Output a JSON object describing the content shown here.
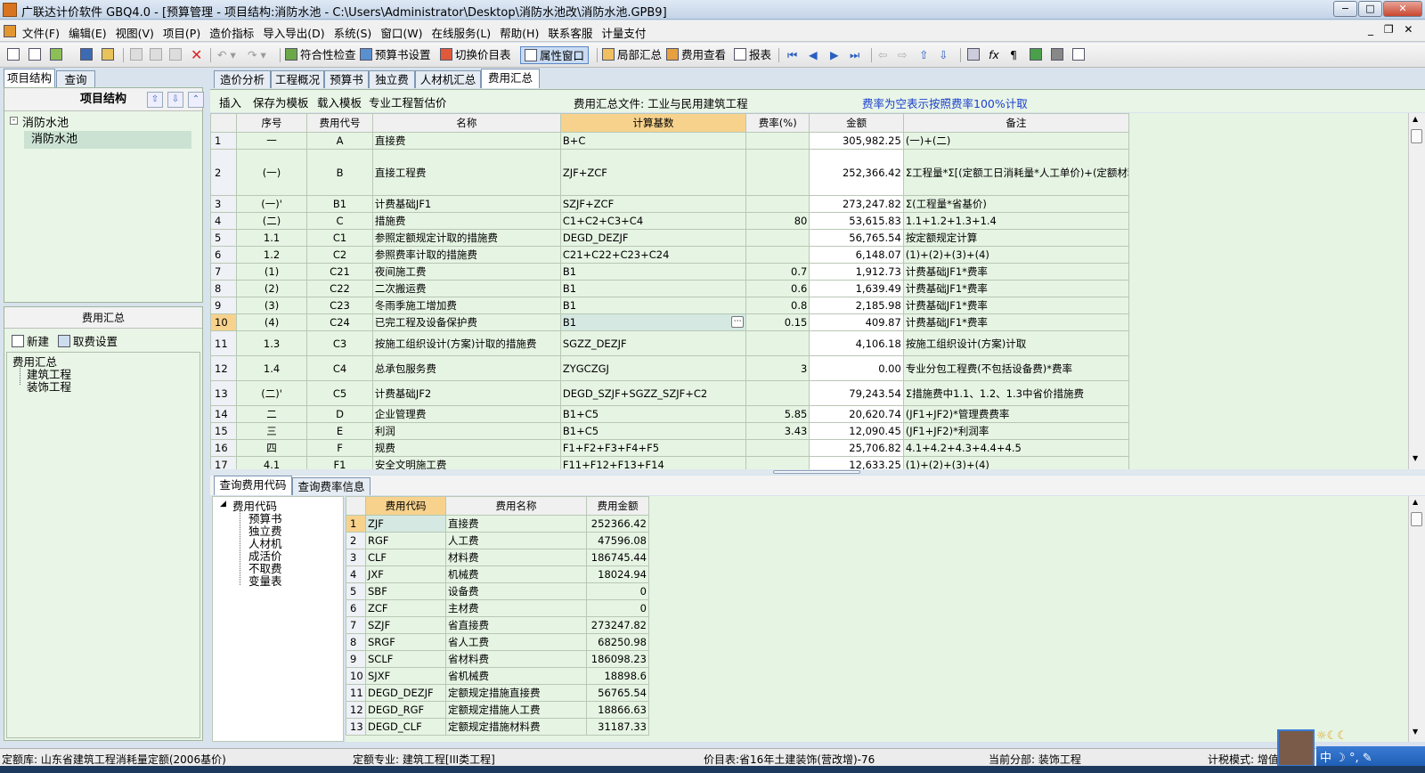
{
  "window": {
    "title": "广联达计价软件 GBQ4.0 - [预算管理 - 项目结构:消防水池 - C:\\Users\\Administrator\\Desktop\\消防水池改\\消防水池.GPB9]",
    "minimize": "−",
    "restore": "□",
    "close": "✕"
  },
  "menu": [
    "文件(F)",
    "编辑(E)",
    "视图(V)",
    "项目(P)",
    "造价指标",
    "导入导出(D)",
    "系统(S)",
    "窗口(W)",
    "在线服务(L)",
    "帮助(H)",
    "联系客服",
    "计量支付"
  ],
  "mdi": {
    "minimize": "_",
    "restore": "❐",
    "close": "✕"
  },
  "toolbar": {
    "check": "符合性检查",
    "budget_settings": "预算书设置",
    "switch_price": "切换价目表",
    "property_window": "属性窗口",
    "local_summary": "局部汇总",
    "fee_view": "费用查看",
    "report": "报表"
  },
  "left_panel": {
    "tabs": [
      "项目结构",
      "查询"
    ],
    "header": "项目结构",
    "tree_root": "消防水池",
    "tree_child": "消防水池",
    "fee_header": "费用汇总",
    "new_btn": "新建",
    "fee_settings_btn": "取费设置",
    "fee_tree_root": "费用汇总",
    "fee_tree_items": [
      "建筑工程",
      "装饰工程"
    ]
  },
  "main_tabs": [
    "造价分析",
    "工程概况",
    "预算书",
    "独立费",
    "人材机汇总",
    "费用汇总"
  ],
  "subtoolbar": {
    "insert": "插入",
    "save_template": "保存为模板",
    "load_template": "载入模板",
    "estimate": "专业工程暂估价",
    "file_label": "费用汇总文件: 工业与民用建筑工程",
    "note": "费率为空表示按照费率100%计取"
  },
  "fee_table": {
    "headers": [
      "序号",
      "费用代号",
      "名称",
      "计算基数",
      "费率(%)",
      "金额",
      "备注"
    ],
    "rows": [
      {
        "n": "1",
        "seq": "一",
        "code": "A",
        "name": "直接费",
        "base": "B+C",
        "rate": "",
        "amount": "305,982.25",
        "note": "(一)+(二)"
      },
      {
        "n": "2",
        "seq": "(一)",
        "code": "B",
        "name": "直接工程费",
        "base": "ZJF+ZCF",
        "rate": "",
        "amount": "252,366.42",
        "note": "Σ工程量*Σ[(定额工日消耗量*人工单价)+(定额材料消耗量*材料单价)+(定额机械台班消耗量*机械台班单价)]"
      },
      {
        "n": "3",
        "seq": "(一)'",
        "code": "B1",
        "name": "计费基础JF1",
        "base": "SZJF+ZCF",
        "rate": "",
        "amount": "273,247.82",
        "note": "Σ(工程量*省基价)"
      },
      {
        "n": "4",
        "seq": "(二)",
        "code": "C",
        "name": "措施费",
        "base": "C1+C2+C3+C4",
        "rate": "80",
        "amount": "53,615.83",
        "note": "1.1+1.2+1.3+1.4"
      },
      {
        "n": "5",
        "seq": "1.1",
        "code": "C1",
        "name": "参照定额规定计取的措施费",
        "base": "DEGD_DEZJF",
        "rate": "",
        "amount": "56,765.54",
        "note": "按定额规定计算"
      },
      {
        "n": "6",
        "seq": "1.2",
        "code": "C2",
        "name": "参照费率计取的措施费",
        "base": "C21+C22+C23+C24",
        "rate": "",
        "amount": "6,148.07",
        "note": "(1)+(2)+(3)+(4)"
      },
      {
        "n": "7",
        "seq": "(1)",
        "code": "C21",
        "name": "夜间施工费",
        "base": "B1",
        "rate": "0.7",
        "amount": "1,912.73",
        "note": "计费基础JF1*费率"
      },
      {
        "n": "8",
        "seq": "(2)",
        "code": "C22",
        "name": "二次搬运费",
        "base": "B1",
        "rate": "0.6",
        "amount": "1,639.49",
        "note": "计费基础JF1*费率"
      },
      {
        "n": "9",
        "seq": "(3)",
        "code": "C23",
        "name": "冬雨季施工增加费",
        "base": "B1",
        "rate": "0.8",
        "amount": "2,185.98",
        "note": "计费基础JF1*费率"
      },
      {
        "n": "10",
        "seq": "(4)",
        "code": "C24",
        "name": "已完工程及设备保护费",
        "base": "B1",
        "rate": "0.15",
        "amount": "409.87",
        "note": "计费基础JF1*费率"
      },
      {
        "n": "11",
        "seq": "1.3",
        "code": "C3",
        "name": "按施工组织设计(方案)计取的措施费",
        "base": "SGZZ_DEZJF",
        "rate": "",
        "amount": "4,106.18",
        "note": "按施工组织设计(方案)计取"
      },
      {
        "n": "12",
        "seq": "1.4",
        "code": "C4",
        "name": "总承包服务费",
        "base": "ZYGCZGJ",
        "rate": "3",
        "amount": "0.00",
        "note": "专业分包工程费(不包括设备费)*费率"
      },
      {
        "n": "13",
        "seq": "(二)'",
        "code": "C5",
        "name": "计费基础JF2",
        "base": "DEGD_SZJF+SGZZ_SZJF+C2",
        "rate": "",
        "amount": "79,243.54",
        "note": "Σ措施费中1.1、1.2、1.3中省价措施费"
      },
      {
        "n": "14",
        "seq": "二",
        "code": "D",
        "name": "企业管理费",
        "base": "B1+C5",
        "rate": "5.85",
        "amount": "20,620.74",
        "note": "(JF1+JF2)*管理费费率"
      },
      {
        "n": "15",
        "seq": "三",
        "code": "E",
        "name": "利润",
        "base": "B1+C5",
        "rate": "3.43",
        "amount": "12,090.45",
        "note": "(JF1+JF2)*利润率"
      },
      {
        "n": "16",
        "seq": "四",
        "code": "F",
        "name": "规费",
        "base": "F1+F2+F3+F4+F5",
        "rate": "",
        "amount": "25,706.82",
        "note": "4.1+4.2+4.3+4.4+4.5"
      },
      {
        "n": "17",
        "seq": "4.1",
        "code": "F1",
        "name": "安全文明施工费",
        "base": "F11+F12+F13+F14",
        "rate": "",
        "amount": "12,633.25",
        "note": "(1)+(2)+(3)+(4)"
      }
    ]
  },
  "bottom_tabs": [
    "查询费用代码",
    "查询费率信息"
  ],
  "code_tree": {
    "root": "费用代码",
    "items": [
      "预算书",
      "独立费",
      "人材机",
      "成活价",
      "不取费",
      "变量表"
    ]
  },
  "code_table": {
    "headers": [
      "费用代码",
      "费用名称",
      "费用金额"
    ],
    "rows": [
      {
        "n": "1",
        "code": "ZJF",
        "name": "直接费",
        "amount": "252366.42"
      },
      {
        "n": "2",
        "code": "RGF",
        "name": "人工费",
        "amount": "47596.08"
      },
      {
        "n": "3",
        "code": "CLF",
        "name": "材料费",
        "amount": "186745.44"
      },
      {
        "n": "4",
        "code": "JXF",
        "name": "机械费",
        "amount": "18024.94"
      },
      {
        "n": "5",
        "code": "SBF",
        "name": "设备费",
        "amount": "0"
      },
      {
        "n": "6",
        "code": "ZCF",
        "name": "主材费",
        "amount": "0"
      },
      {
        "n": "7",
        "code": "SZJF",
        "name": "省直接费",
        "amount": "273247.82"
      },
      {
        "n": "8",
        "code": "SRGF",
        "name": "省人工费",
        "amount": "68250.98"
      },
      {
        "n": "9",
        "code": "SCLF",
        "name": "省材料费",
        "amount": "186098.23"
      },
      {
        "n": "10",
        "code": "SJXF",
        "name": "省机械费",
        "amount": "18898.6"
      },
      {
        "n": "11",
        "code": "DEGD_DEZJF",
        "name": "定额规定措施直接费",
        "amount": "56765.54"
      },
      {
        "n": "12",
        "code": "DEGD_RGF",
        "name": "定额规定措施人工费",
        "amount": "18866.63"
      },
      {
        "n": "13",
        "code": "DEGD_CLF",
        "name": "定额规定措施材料费",
        "amount": "31187.33"
      }
    ]
  },
  "status": {
    "quota_lib": "定额库: 山东省建筑工程消耗量定额(2006基价)",
    "quota_major": "定额专业: 建筑工程[III类工程]",
    "price_table": "价目表:省16年土建装饰(营改增)-76",
    "current_part": "当前分部: 装饰工程",
    "tax_mode": "计税模式: 增值"
  },
  "ime": {
    "lang": "中",
    "moon": "☽",
    "punct": "°,",
    "tools": "✎"
  }
}
